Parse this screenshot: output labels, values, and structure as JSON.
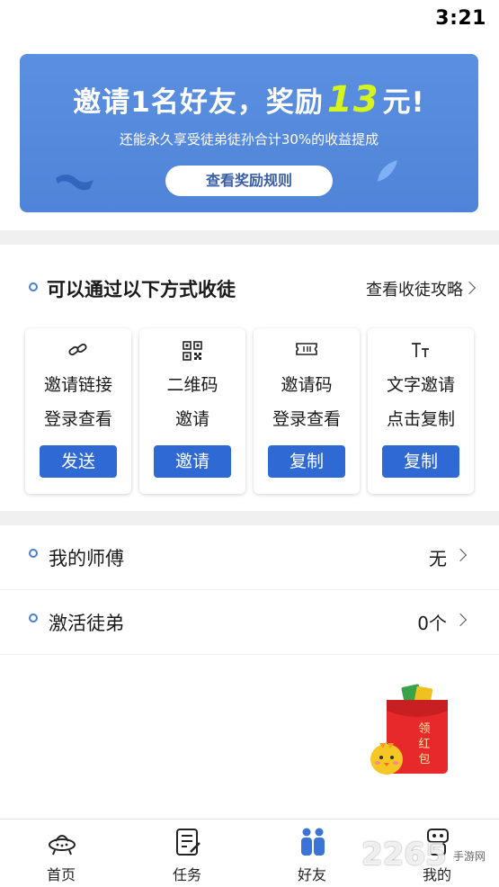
{
  "status_bar": {
    "time": "3:21"
  },
  "banner": {
    "title_prefix": "邀请1名好友，奖励",
    "title_amount": "13",
    "title_suffix": "元!",
    "subtitle": "还能永久享受徒弟徒孙合计30%的收益提成",
    "button_label": "查看奖励规则",
    "accent_color": "#d7f51c",
    "background_color": "#5b8fe0"
  },
  "invite_section": {
    "title": "可以通过以下方式收徒",
    "link_label": "查看收徒攻略",
    "cards": [
      {
        "icon": "link-icon",
        "line1": "邀请链接",
        "line2": "登录查看",
        "button": "发送"
      },
      {
        "icon": "qr-code-icon",
        "line1": "二维码",
        "line2": "邀请",
        "button": "邀请"
      },
      {
        "icon": "ticket-icon",
        "line1": "邀请码",
        "line2": "登录查看",
        "button": "复制"
      },
      {
        "icon": "text-icon",
        "line1": "文字邀请",
        "line2": "点击复制",
        "button": "复制"
      }
    ]
  },
  "rows": [
    {
      "label": "我的师傅",
      "value": "无"
    },
    {
      "label": "激活徒弟",
      "value": "0个"
    }
  ],
  "red_packet": {
    "text": "领红包"
  },
  "watermark": {
    "big": "2265",
    "small": "手游网"
  },
  "tabbar": {
    "tabs": [
      {
        "label": "首页",
        "icon": "ufo-home-icon"
      },
      {
        "label": "任务",
        "icon": "task-list-icon"
      },
      {
        "label": "好友",
        "icon": "friends-icon",
        "active": true
      },
      {
        "label": "我的",
        "icon": "robot-profile-icon"
      }
    ],
    "active_color": "#3b73d6"
  }
}
